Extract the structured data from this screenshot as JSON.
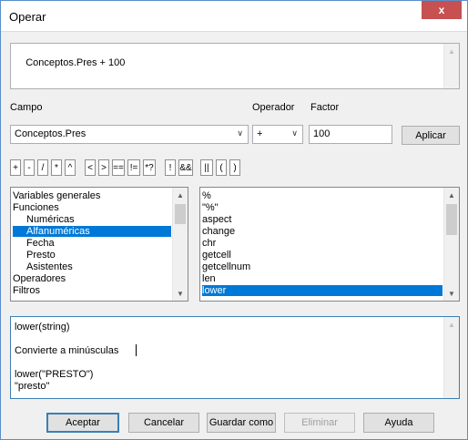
{
  "title": "Operar",
  "close_glyph": "x",
  "formula": "Conceptos.Pres + 100",
  "labels": {
    "campo": "Campo",
    "operador": "Operador",
    "factor": "Factor"
  },
  "campo_value": "Conceptos.Pres",
  "operador_value": "+",
  "factor_value": "100",
  "apply_label": "Aplicar",
  "operators": [
    "+",
    "-",
    "/",
    "*",
    "^",
    "<",
    ">",
    "==",
    "!=",
    "*?",
    "!",
    "&&",
    "||",
    "(",
    ")"
  ],
  "categories": [
    {
      "label": "Variables generales",
      "indent": 0
    },
    {
      "label": "Funciones",
      "indent": 0
    },
    {
      "label": "Numéricas",
      "indent": 1
    },
    {
      "label": "Alfanuméricas",
      "indent": 1,
      "selected": true
    },
    {
      "label": "Fecha",
      "indent": 1
    },
    {
      "label": "Presto",
      "indent": 1
    },
    {
      "label": "Asistentes",
      "indent": 1
    },
    {
      "label": "Operadores",
      "indent": 0
    },
    {
      "label": "Filtros",
      "indent": 0
    }
  ],
  "functions": [
    {
      "label": "%"
    },
    {
      "label": "\"%\""
    },
    {
      "label": "aspect"
    },
    {
      "label": "change"
    },
    {
      "label": "chr"
    },
    {
      "label": "getcell"
    },
    {
      "label": "getcellnum"
    },
    {
      "label": "len"
    },
    {
      "label": "lower",
      "selected": true
    }
  ],
  "help": {
    "signature": "lower(string)",
    "description": "Convierte a minúsculas",
    "example_call": "lower(\"PRESTO\")",
    "example_result": "\"presto\""
  },
  "buttons": {
    "accept": "Aceptar",
    "cancel": "Cancelar",
    "save_as": "Guardar como",
    "delete": "Eliminar",
    "help": "Ayuda"
  },
  "scroll_glyphs": {
    "up": "▲",
    "down": "▼",
    "combo": "∨"
  }
}
